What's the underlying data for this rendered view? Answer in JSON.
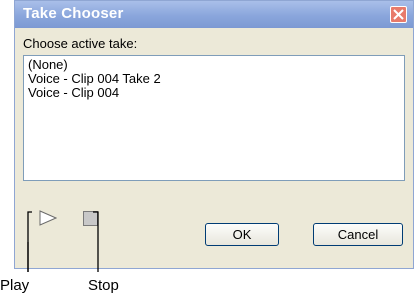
{
  "window": {
    "title": "Take Chooser"
  },
  "dialog": {
    "prompt": "Choose active take:",
    "takes": [
      "(None)",
      "Voice - Clip 004 Take 2",
      "Voice - Clip 004"
    ],
    "buttons": {
      "ok": "OK",
      "cancel": "Cancel"
    }
  },
  "callouts": {
    "play": "Play",
    "stop": "Stop"
  },
  "colors": {
    "titlebar": "#8aa6dc",
    "dialog_bg": "#ece9d8",
    "close": "#e87a6a"
  },
  "icons": [
    "close-icon",
    "play-icon",
    "stop-icon"
  ]
}
